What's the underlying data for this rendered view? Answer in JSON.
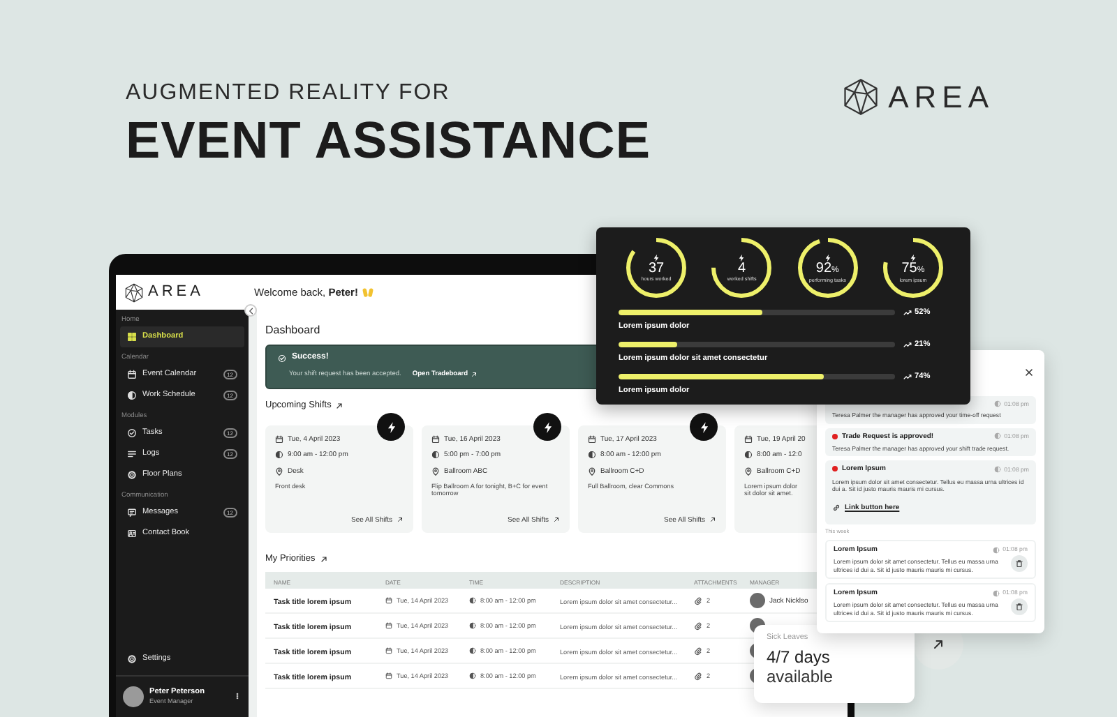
{
  "hero": {
    "kicker": "AUGMENTED REALITY FOR",
    "title": "EVENT ASSISTANCE",
    "logo_text": "AREA"
  },
  "sidebar": {
    "logo_text": "AREA",
    "sections": [
      {
        "label": "Home",
        "items": [
          {
            "label": "Dashboard",
            "selected": true
          }
        ]
      },
      {
        "label": "Calendar",
        "items": [
          {
            "label": "Event Calendar",
            "badge": "12",
            "selected": false
          },
          {
            "label": "Work Schedule",
            "badge": "12",
            "selected": false
          }
        ]
      },
      {
        "label": "Modules",
        "items": [
          {
            "label": "Tasks",
            "badge": "12",
            "selected": false
          },
          {
            "label": "Logs",
            "badge": "12",
            "selected": false
          },
          {
            "label": "Floor Plans",
            "selected": false
          }
        ]
      },
      {
        "label": "Communication",
        "items": [
          {
            "label": "Messages",
            "badge": "12",
            "selected": false
          },
          {
            "label": "Contact Book",
            "selected": false
          }
        ]
      }
    ],
    "settings": "Settings",
    "user": {
      "name": "Peter Peterson",
      "role": "Event Manager"
    }
  },
  "topbar": {
    "greeting": "Welcome back, **Peter!**"
  },
  "dashboard": {
    "title": "Dashboard",
    "alert": {
      "title": "Success!",
      "message": "Your shift request has been accepted.",
      "link": "Open Tradeboard"
    },
    "shifts_title": "Upcoming Shifts",
    "shifts": [
      {
        "date": "Tue, 4 April 2023",
        "time": "9:00 am - 12:00 pm",
        "location": "Desk",
        "note": "Front desk",
        "link": "See All Shifts"
      },
      {
        "date": "Tue, 16 April 2023",
        "time": "5:00 pm - 7:00 pm",
        "location": "Ballroom ABC",
        "note": "Flip Ballroom A for tonight, B+C for event tomorrow",
        "link": "See All Shifts"
      },
      {
        "date": "Tue, 17 April 2023",
        "time": "8:00 am - 12:00 pm",
        "location": "Ballroom C+D",
        "note": "Full Ballroom, clear Commons",
        "link": "See All Shifts"
      },
      {
        "date": "Tue, 19 April 20",
        "time": "8:00 am - 12:0",
        "location": "Ballroom C+D",
        "note": "Lorem ipsum dolor sit dolor sit amet."
      }
    ],
    "priorities_title": "My Priorities",
    "table": {
      "columns": [
        "NAME",
        "DATE",
        "TIME",
        "DESCRIPTION",
        "ATTACHMENTS",
        "MANAGER"
      ],
      "rows": [
        {
          "name": "Task title lorem ipsum",
          "date": "Tue, 14 April 2023",
          "time": "8:00 am - 12:00 pm",
          "description": "Lorem ipsum dolor sit amet consectetur...",
          "attachments": "2",
          "manager": "Jack Nicklso"
        },
        {
          "name": "Task title lorem ipsum",
          "date": "Tue, 14 April 2023",
          "time": "8:00 am - 12:00 pm",
          "description": "Lorem ipsum dolor sit amet consectetur...",
          "attachments": "2"
        },
        {
          "name": "Task title lorem ipsum",
          "date": "Tue, 14 April 2023",
          "time": "8:00 am - 12:00 pm",
          "description": "Lorem ipsum dolor sit amet consectetur...",
          "attachments": "2"
        },
        {
          "name": "Task title lorem ipsum",
          "date": "Tue, 14 April 2023",
          "time": "8:00 am - 12:00 pm",
          "description": "Lorem ipsum dolor sit amet consectetur...",
          "attachments": "2"
        }
      ]
    }
  },
  "stats_card": {
    "rings": [
      {
        "value": "37",
        "caption": "hours worked",
        "level": 0.85
      },
      {
        "value": "4",
        "caption": "worked shifts",
        "level": 0.75
      },
      {
        "value": "92",
        "unit": "%",
        "caption": "performing tasks",
        "level": 0.95
      },
      {
        "value": "75",
        "unit": "%",
        "caption": "lorem ipsum",
        "level": 0.78
      }
    ],
    "bars": [
      {
        "label": "Lorem ipsum dolor",
        "level": 0.52,
        "reading": "52%"
      },
      {
        "label": "Lorem ipsum dolor sit amet consectetur",
        "level": 0.21,
        "reading": "21%"
      },
      {
        "label": "Lorem ipsum dolor",
        "level": 0.74,
        "reading": "74%"
      }
    ]
  },
  "notifications": {
    "recent": [
      {
        "time": "01:08 pm",
        "text": "Teresa Palmer the manager has approved your time-off request",
        "unread": false
      },
      {
        "title": "Trade Request is approved!",
        "time": "01:08 pm",
        "text": "Teresa Palmer the manager has approved your shift trade request.",
        "unread": true
      },
      {
        "title": "Lorem Ipsum",
        "time": "01:08 pm",
        "text": "Lorem ipsum dolor sit amet consectetur. Tellus eu massa urna ultrices id dui a. Sit id justo mauris mauris mi cursus.",
        "unread": true,
        "link": "Link button here"
      }
    ],
    "section_label": "This week",
    "this_week": [
      {
        "title": "Lorem Ipsum",
        "time": "01:08 pm",
        "text": "Lorem ipsum dolor sit amet consectetur. Tellus eu massa urna ultrices id dui a. Sit id justo mauris mauris mi cursus."
      },
      {
        "title": "Lorem Ipsum",
        "time": "01:08 pm",
        "text": "Lorem ipsum dolor sit amet consectetur. Tellus eu massa urna ultrices id dui a. Sit id justo mauris mauris mi cursus."
      }
    ]
  },
  "sick_leaves": {
    "label": "Sick Leaves",
    "value": "4/7 days",
    "note": "available"
  }
}
